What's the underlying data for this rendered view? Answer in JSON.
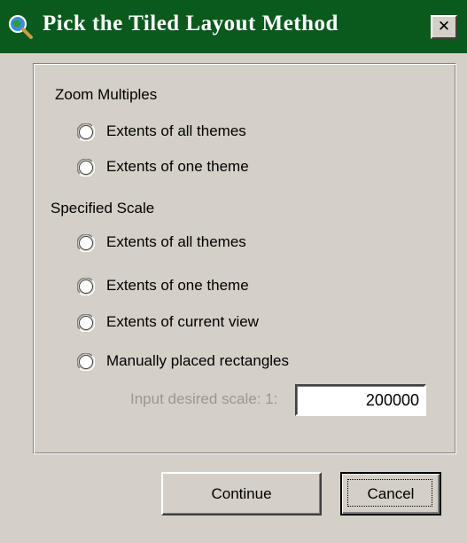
{
  "window": {
    "title": "Pick the Tiled Layout Method",
    "close_label": "✕",
    "title_icon": "globe-magnifier-icon"
  },
  "sections": [
    {
      "label": "Zoom Multiples",
      "options": [
        {
          "label": "Extents of all themes",
          "selected": false
        },
        {
          "label": "Extents of one theme",
          "selected": false
        }
      ]
    },
    {
      "label": "Specified Scale",
      "options": [
        {
          "label": "Extents of all themes",
          "selected": false
        },
        {
          "label": "Extents of one theme",
          "selected": false
        },
        {
          "label": "Extents of current view",
          "selected": false
        },
        {
          "label": "Manually placed rectangles",
          "selected": false
        }
      ]
    }
  ],
  "scale": {
    "label": "Input desired scale:  1:",
    "value": "200000",
    "enabled": false
  },
  "buttons": {
    "continue_label": "Continue",
    "cancel_label": "Cancel"
  },
  "colors": {
    "titlebar": "#0a5a1e",
    "dialog_face": "#d4d0c8",
    "disabled_text": "#9a9890"
  }
}
